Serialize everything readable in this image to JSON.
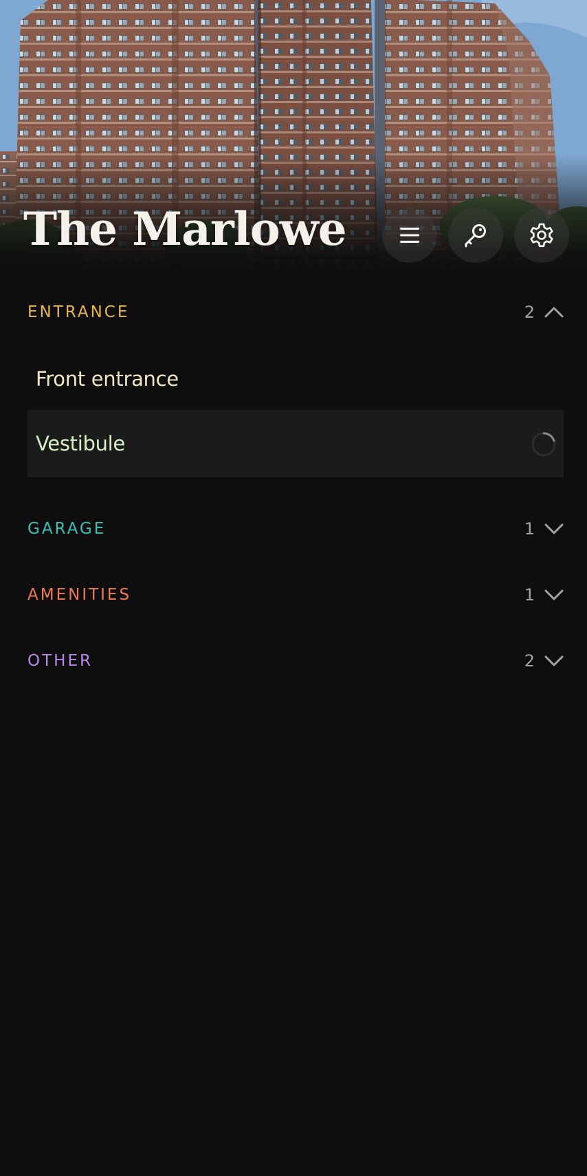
{
  "header": {
    "title": "The Marlowe",
    "buttons": [
      {
        "icon": "menu-icon"
      },
      {
        "icon": "key-icon"
      },
      {
        "icon": "gear-icon"
      }
    ]
  },
  "sections": [
    {
      "title": "ENTRANCE",
      "count": "2",
      "color": "#e8b64a",
      "expanded": true,
      "items": [
        {
          "label": "Front entrance",
          "color": "#f1e6c6"
        },
        {
          "label": "Vestibule",
          "color": "#d6f0c4",
          "selected": true,
          "loading": true
        }
      ]
    },
    {
      "title": "GARAGE",
      "count": "1",
      "color": "#3fc0b6",
      "expanded": false
    },
    {
      "title": "AMENITIES",
      "count": "1",
      "color": "#f07a55",
      "expanded": false
    },
    {
      "title": "OTHER",
      "count": "2",
      "color": "#b987ea",
      "expanded": false
    }
  ],
  "colors": {
    "background": "#0e0e0e",
    "row_highlight": "#1b1b1b",
    "muted": "#a3a3a3"
  }
}
